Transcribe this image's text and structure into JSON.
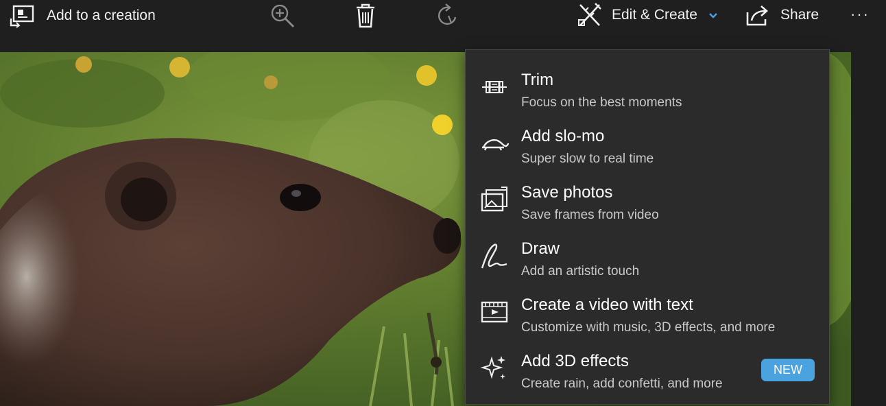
{
  "toolbar": {
    "add_to_creation": "Add to a creation",
    "zoom_icon": "zoom-in-icon",
    "delete_icon": "trash-icon",
    "rotate_icon": "rotate-icon",
    "edit_create": "Edit & Create",
    "share": "Share",
    "more": "···"
  },
  "photo": {
    "subject": "marmot-photo"
  },
  "menu": {
    "items": [
      {
        "title": "Trim",
        "subtitle": "Focus on the best moments",
        "icon": "trim-icon"
      },
      {
        "title": "Add slo-mo",
        "subtitle": "Super slow to real time",
        "icon": "turtle-icon"
      },
      {
        "title": "Save photos",
        "subtitle": "Save frames from video",
        "icon": "save-frames-icon"
      },
      {
        "title": "Draw",
        "subtitle": "Add an artistic touch",
        "icon": "draw-icon"
      },
      {
        "title": "Create a video with text",
        "subtitle": "Customize with music, 3D effects, and more",
        "icon": "video-text-icon"
      },
      {
        "title": "Add 3D effects",
        "subtitle": "Create rain, add confetti, and more",
        "icon": "sparkle-icon",
        "badge": "NEW"
      }
    ]
  },
  "colors": {
    "background": "#1f1f1f",
    "menu_bg": "#2b2b2b",
    "accent": "#4aa3df"
  }
}
